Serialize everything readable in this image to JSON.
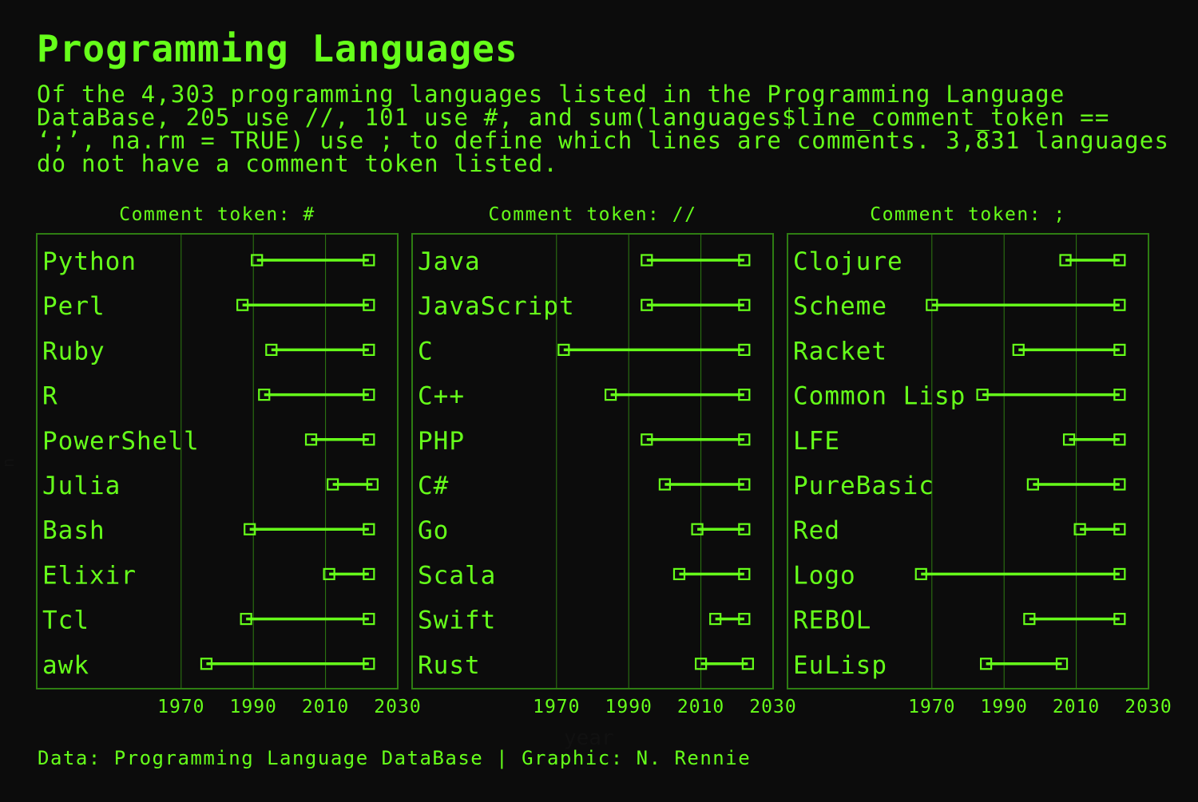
{
  "title": "Programming Languages",
  "subtitle": "Of the 4,303 programming languages listed in the Programming Language DataBase, 205 use //, 101 use #, and sum(languages$line_comment_token == ‘;’, na.rm = TRUE) use ; to define which lines are comments. 3,831 languages do not have a comment token listed.",
  "caption": "Data: Programming Language DataBase | Graphic: N. Rennie",
  "colors": {
    "background": "#0c0c0c",
    "accent": "#66ff1a",
    "grid": "#2e7d12"
  },
  "chart_data": {
    "type": "dumbbell",
    "xlabel": "year",
    "ylabel": "n",
    "xlim": [
      1930,
      2030
    ],
    "xticks": [
      1970,
      1990,
      2010,
      2030
    ],
    "panels": [
      {
        "strip": "Comment token: #",
        "languages": [
          {
            "name": "Python",
            "start": 1991,
            "end": 2022
          },
          {
            "name": "Perl",
            "start": 1987,
            "end": 2022
          },
          {
            "name": "Ruby",
            "start": 1995,
            "end": 2022
          },
          {
            "name": "R",
            "start": 1993,
            "end": 2022
          },
          {
            "name": "PowerShell",
            "start": 2006,
            "end": 2022
          },
          {
            "name": "Julia",
            "start": 2012,
            "end": 2023
          },
          {
            "name": "Bash",
            "start": 1989,
            "end": 2022
          },
          {
            "name": "Elixir",
            "start": 2011,
            "end": 2022
          },
          {
            "name": "Tcl",
            "start": 1988,
            "end": 2022
          },
          {
            "name": "awk",
            "start": 1977,
            "end": 2022
          }
        ]
      },
      {
        "strip": "Comment token: //",
        "languages": [
          {
            "name": "Java",
            "start": 1995,
            "end": 2022
          },
          {
            "name": "JavaScript",
            "start": 1995,
            "end": 2022
          },
          {
            "name": "C",
            "start": 1972,
            "end": 2022
          },
          {
            "name": "C++",
            "start": 1985,
            "end": 2022
          },
          {
            "name": "PHP",
            "start": 1995,
            "end": 2022
          },
          {
            "name": "C#",
            "start": 2000,
            "end": 2022
          },
          {
            "name": "Go",
            "start": 2009,
            "end": 2022
          },
          {
            "name": "Scala",
            "start": 2004,
            "end": 2022
          },
          {
            "name": "Swift",
            "start": 2014,
            "end": 2022
          },
          {
            "name": "Rust",
            "start": 2010,
            "end": 2023
          }
        ]
      },
      {
        "strip": "Comment token: ;",
        "languages": [
          {
            "name": "Clojure",
            "start": 2007,
            "end": 2022
          },
          {
            "name": "Scheme",
            "start": 1970,
            "end": 2022
          },
          {
            "name": "Racket",
            "start": 1994,
            "end": 2022
          },
          {
            "name": "Common Lisp",
            "start": 1984,
            "end": 2022
          },
          {
            "name": "LFE",
            "start": 2008,
            "end": 2022
          },
          {
            "name": "PureBasic",
            "start": 1998,
            "end": 2022
          },
          {
            "name": "Red",
            "start": 2011,
            "end": 2022
          },
          {
            "name": "Logo",
            "start": 1967,
            "end": 2022
          },
          {
            "name": "REBOL",
            "start": 1997,
            "end": 2022
          },
          {
            "name": "EuLisp",
            "start": 1985,
            "end": 2006
          }
        ]
      }
    ]
  }
}
